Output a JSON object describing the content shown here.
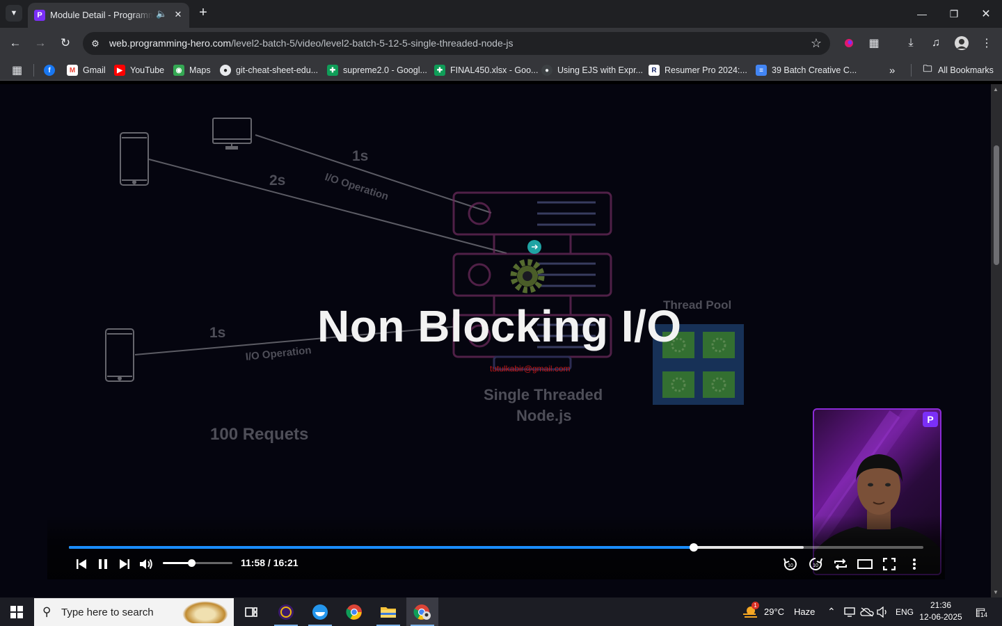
{
  "browser": {
    "tab": {
      "title": "Module Detail - Programming Hero",
      "audio_icon": "speaker-icon",
      "close_icon": "close-icon"
    },
    "window_controls": [
      "minimize-icon",
      "restore-icon",
      "close-icon"
    ],
    "url": {
      "host": "web.programming-hero.com",
      "path": "/level2-batch-5/video/level2-batch-5-12-5-single-threaded-node-js"
    },
    "bookmarks": [
      {
        "label": "",
        "icon": "facebook-icon",
        "color": "#1877f2"
      },
      {
        "label": "Gmail",
        "icon": "gmail-icon",
        "color": "#ea4335"
      },
      {
        "label": "YouTube",
        "icon": "youtube-icon",
        "color": "#ff0000"
      },
      {
        "label": "Maps",
        "icon": "maps-icon",
        "color": "#34a853"
      },
      {
        "label": "git-cheat-sheet-edu...",
        "icon": "github-icon",
        "color": "#e8eaed"
      },
      {
        "label": "supreme2.0 - Googl...",
        "icon": "sheets-icon",
        "color": "#0f9d58"
      },
      {
        "label": "FINAL450.xlsx - Goo...",
        "icon": "sheets-icon",
        "color": "#0f9d58"
      },
      {
        "label": "Using EJS with Expr...",
        "icon": "github-icon",
        "color": "#e8eaed"
      },
      {
        "label": "Resumer Pro 2024:...",
        "icon": "resumer-icon",
        "color": "#ffffff"
      },
      {
        "label": "39 Batch Creative C...",
        "icon": "docs-icon",
        "color": "#4285f4"
      }
    ],
    "more_bookmarks_icon": "chevron-double-right-icon",
    "all_bookmarks": "All Bookmarks"
  },
  "video": {
    "slide": {
      "headline": "Non Blocking I/O",
      "label_1s_top": "1s",
      "label_2s": "2s",
      "label_io_top": "I/O Operation",
      "label_1s_bottom": "1s",
      "label_io_bottom": "I/O Operation",
      "thread_pool": "Thread Pool",
      "server_caption_line1": "Single Threaded",
      "server_caption_line2": "Node.js",
      "requests": "100 Requets",
      "watermark_email": "tutulkabir@gmail.com"
    },
    "player": {
      "current_time": "11:58",
      "separator": "/",
      "duration": "16:21",
      "progress_fraction": 0.731,
      "buffered_fraction": 0.86,
      "volume_fraction": 0.41,
      "timecode": "11:58 / 16:21"
    }
  },
  "taskbar": {
    "search_placeholder": "Type here to search",
    "weather": {
      "temp": "29°C",
      "condition": "Haze",
      "alert_count": "1"
    },
    "language": "ENG",
    "time": "21:36",
    "date": "12-06-2025",
    "notification_count": "14"
  }
}
